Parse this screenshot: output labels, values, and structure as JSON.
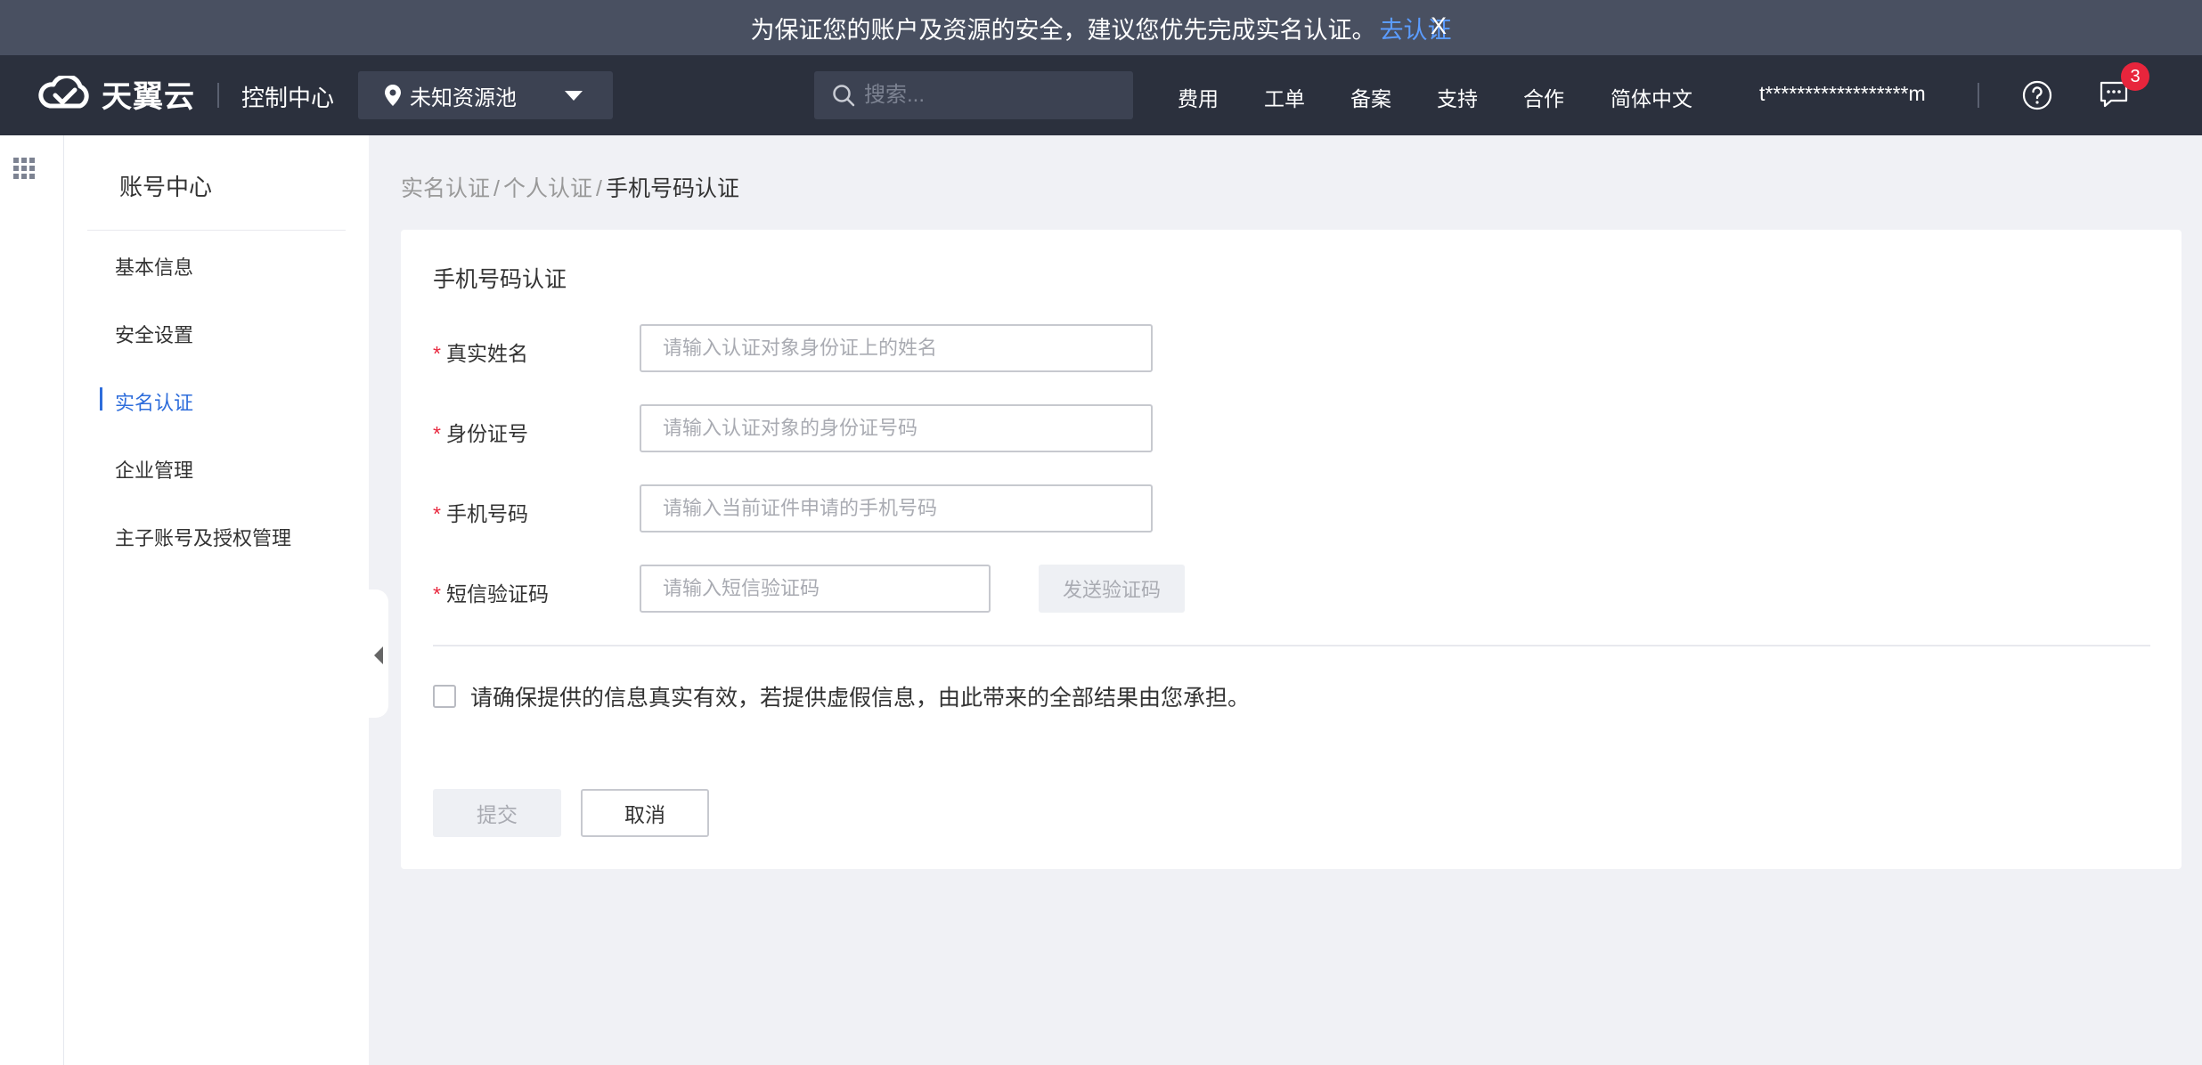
{
  "notice": {
    "text": "为保证您的账户及资源的安全，建议您优先完成实名认证。",
    "link": "去认证",
    "close": "X"
  },
  "navbar": {
    "brand": "天翼云",
    "console": "控制中心",
    "pool": "未知资源池",
    "search_placeholder": "搜索...",
    "items": [
      "费用",
      "工单",
      "备案",
      "支持",
      "合作",
      "简体中文"
    ],
    "account": "t******************m",
    "message_count": "3"
  },
  "sidebar": {
    "title": "账号中心",
    "items": [
      {
        "label": "基本信息"
      },
      {
        "label": "安全设置"
      },
      {
        "label": "实名认证"
      },
      {
        "label": "企业管理"
      },
      {
        "label": "主子账号及授权管理"
      }
    ]
  },
  "breadcrumb": {
    "items": [
      "实名认证",
      "个人认证"
    ],
    "current": "手机号码认证"
  },
  "form": {
    "title": "手机号码认证",
    "required_mark": "*",
    "fields": [
      {
        "label": "真实姓名",
        "placeholder": "请输入认证对象身份证上的姓名"
      },
      {
        "label": "身份证号",
        "placeholder": "请输入认证对象的身份证号码"
      },
      {
        "label": "手机号码",
        "placeholder": "请输入当前证件申请的手机号码"
      },
      {
        "label": "短信验证码",
        "placeholder": "请输入短信验证码"
      }
    ],
    "send_code": "发送验证码",
    "agreement": "请确保提供的信息真实有效，若提供虚假信息，由此带来的全部结果由您承担。",
    "submit": "提交",
    "cancel": "取消"
  },
  "colors": {
    "accent": "#2e6ddb",
    "notice_bg": "#495061",
    "navbar_bg": "#2b303d",
    "badge": "#e8253c"
  }
}
